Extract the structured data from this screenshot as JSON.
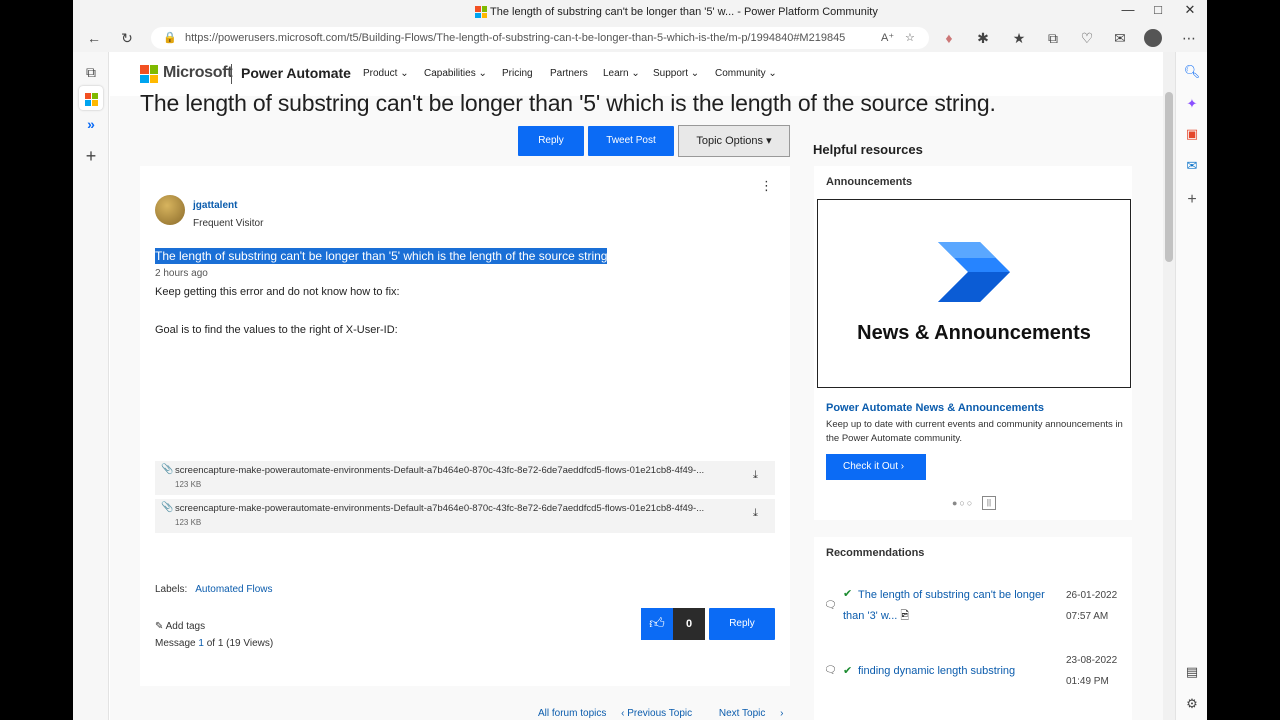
{
  "window": {
    "title": "The length of substring can't be longer than '5' w... - Power Platform Community",
    "url": "https://powerusers.microsoft.com/t5/Building-Flows/The-length-of-substring-can-t-be-longer-than-5-which-is-the/m-p/1994840#M219845"
  },
  "nav": {
    "ms_word": "Microsoft",
    "product_name": "Power Automate",
    "items": [
      "Product",
      "Capabilities",
      "Pricing",
      "Partners",
      "Learn",
      "Support",
      "Community"
    ]
  },
  "post": {
    "title": "The length of substring can't be longer than '5' which is the length of the source string.",
    "reply_label": "Reply",
    "tweet_label": "Tweet Post",
    "topic_options_label": "Topic Options",
    "username": "jgattalent",
    "user_rank": "Frequent Visitor",
    "subject": "The length of substring can't be longer than '5' which is the length of the source string",
    "time": "2 hours ago",
    "body_line1": "Keep getting this error and do not know how to fix:",
    "body_line2": "Goal is to find the values to the right of X-User-ID:",
    "attachments": [
      {
        "name": "screencapture-make-powerautomate-environments-Default-a7b464e0-870c-43fc-8e72-6de7aeddfcd5-flows-01e21cb8-4f49-...",
        "size": "123 KB"
      },
      {
        "name": "screencapture-make-powerautomate-environments-Default-a7b464e0-870c-43fc-8e72-6de7aeddfcd5-flows-01e21cb8-4f49-...",
        "size": "123 KB"
      }
    ],
    "labels_label": "Labels:",
    "label_value": "Automated Flows",
    "add_tags": "Add tags",
    "message_prefix": "Message",
    "message_num": "1",
    "message_suffix": "of 1 (19 Views)",
    "like_count": "0",
    "reply_bottom_label": "Reply"
  },
  "pager": {
    "all": "All forum topics",
    "prev": "Previous Topic",
    "next": "Next Topic"
  },
  "sidebar": {
    "helpful": "Helpful resources",
    "ann_header": "Announcements",
    "ann_image_title": "News & Announcements",
    "ann_link": "Power Automate News & Announcements",
    "ann_desc": "Keep up to date with current events and community announcements in the Power Automate community.",
    "check_out": "Check it Out",
    "rec_header": "Recommendations",
    "recs": [
      {
        "title_line1": "The length of substring can't be longer",
        "title_line2": "than '3' w...",
        "date": "26-01-2022",
        "time": "07:57 AM"
      },
      {
        "title_line1": "finding dynamic length substring",
        "title_line2": "",
        "date": "23-08-2022",
        "time": "01:49 PM"
      }
    ]
  },
  "colors": {
    "accent_blue": "#0b6bf5",
    "link_blue": "#0b5cad",
    "selection": "#1a6fd6"
  }
}
